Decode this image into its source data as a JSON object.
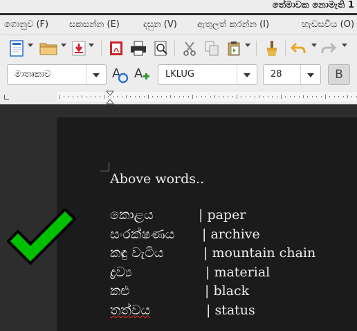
{
  "window": {
    "title": "තේමාවක නොමැති 1"
  },
  "menu": [
    {
      "label": "ගොනුව (F)"
    },
    {
      "label": "සකසන්න (E)"
    },
    {
      "label": "දසුන (V)"
    },
    {
      "label": "ඇතුලත් කරන්න (I)"
    },
    {
      "label": "හැඩසවිය (O)"
    }
  ],
  "toolbar": {
    "icons": [
      "new-document-icon",
      "open-folder-icon",
      "save-icon",
      "export-pdf-icon",
      "print-icon",
      "print-preview-icon",
      "cut-icon",
      "copy-icon",
      "paste-icon",
      "clone-formatting-icon",
      "undo-icon",
      "redo-icon"
    ]
  },
  "format": {
    "paragraph_style": "මාතෘකාව",
    "font_name": "LKLUG",
    "font_size": "28",
    "bold_label": "B"
  },
  "document": {
    "heading": "Above words..",
    "rows": [
      {
        "si": "කොළය",
        "en": "| paper"
      },
      {
        "si": "සංරක්ෂණය",
        "en": "| archive"
      },
      {
        "si": "කඳු වැටිය",
        "en": "| mountain chain"
      },
      {
        "si": "ද්‍රව්‍ය",
        "en": "| material"
      },
      {
        "si": "කළු",
        "en": "| black"
      },
      {
        "si": "තත්වය",
        "en": "| status"
      }
    ]
  },
  "overlay": {
    "icon": "green-checkmark-icon",
    "color": "#00c000"
  },
  "colors": {
    "chrome": "#ededed",
    "canvas": "#2d2d2d",
    "page": "#1b1b1b",
    "text": "#eeeeee"
  }
}
